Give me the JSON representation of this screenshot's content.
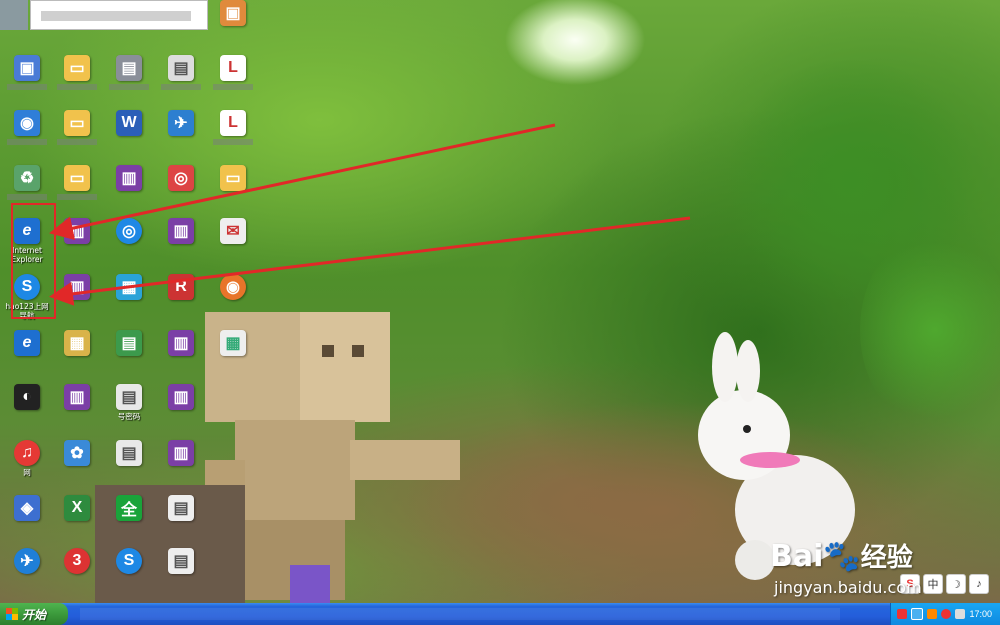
{
  "desktop": {
    "icons": [
      {
        "id": "my-computer",
        "label": "",
        "color": "#4a7bd6",
        "glyph": "▣"
      },
      {
        "id": "internet-explorer",
        "label": "Internet\nExplorer",
        "color": "#1e6fd0",
        "glyph": "e"
      },
      {
        "id": "hao123",
        "label": "hao123上网\n导航",
        "color": "#1e88e5",
        "glyph": "S"
      },
      {
        "id": "address-book",
        "label": "号密码",
        "color": "#dddddd",
        "glyph": "▤"
      },
      {
        "id": "netease-music",
        "label": "网",
        "color": "#e53935",
        "glyph": "♫"
      }
    ],
    "highlight_note": "Internet Explorer and hao123上网导航 icons highlighted with red arrows"
  },
  "taskbar": {
    "start_label": "开始",
    "clock": "17:00"
  },
  "watermark": {
    "brand": "Bai",
    "brand_cn": "经验",
    "url": "jingyan.baidu.com"
  },
  "ime": {
    "buttons": [
      "S",
      "中",
      "☽",
      "♪"
    ]
  }
}
